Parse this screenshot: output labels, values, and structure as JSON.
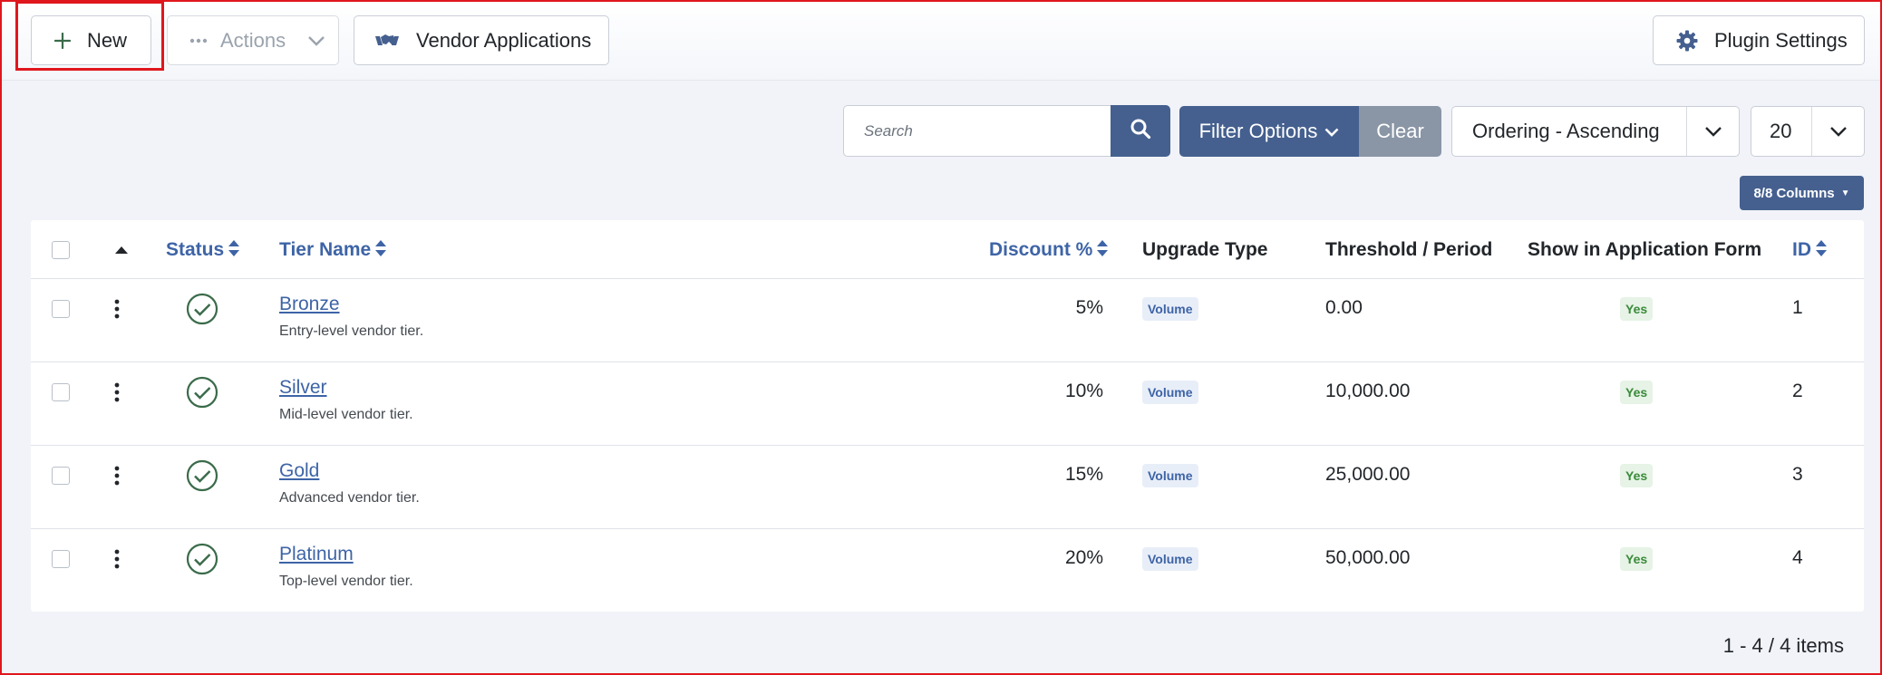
{
  "toolbar": {
    "new_label": "New",
    "actions_label": "Actions",
    "vendor_label": "Vendor Applications",
    "plugin_label": "Plugin Settings"
  },
  "filters": {
    "search_placeholder": "Search",
    "filter_options_label": "Filter Options",
    "clear_label": "Clear",
    "ordering_value": "Ordering - Ascending",
    "limit_value": "20",
    "columns_label": "8/8 Columns"
  },
  "table": {
    "headers": {
      "status": "Status",
      "tier_name": "Tier Name",
      "discount": "Discount %",
      "upgrade_type": "Upgrade Type",
      "threshold": "Threshold / Period",
      "show_in_form": "Show in Application Form",
      "id": "ID"
    },
    "rows": [
      {
        "name": "Bronze",
        "description": "Entry-level vendor tier.",
        "discount": "5%",
        "upgrade_type": "Volume",
        "threshold": "0.00",
        "show_in_form": "Yes",
        "id": "1"
      },
      {
        "name": "Silver",
        "description": "Mid-level vendor tier.",
        "discount": "10%",
        "upgrade_type": "Volume",
        "threshold": "10,000.00",
        "show_in_form": "Yes",
        "id": "2"
      },
      {
        "name": "Gold",
        "description": "Advanced vendor tier.",
        "discount": "15%",
        "upgrade_type": "Volume",
        "threshold": "25,000.00",
        "show_in_form": "Yes",
        "id": "3"
      },
      {
        "name": "Platinum",
        "description": "Top-level vendor tier.",
        "discount": "20%",
        "upgrade_type": "Volume",
        "threshold": "50,000.00",
        "show_in_form": "Yes",
        "id": "4"
      }
    ]
  },
  "pagination": {
    "summary": "1 - 4 / 4 items"
  },
  "colors": {
    "primary": "#45608f",
    "link": "#3e64a6",
    "published": "#3a6b4a",
    "highlight": "#e0161d"
  },
  "icons": {
    "new": "plus-icon",
    "actions": "ellipsis-icon",
    "vendor": "handshake-icon",
    "plugin": "gear-icon",
    "search": "search-icon",
    "status": "check-circle-icon"
  }
}
